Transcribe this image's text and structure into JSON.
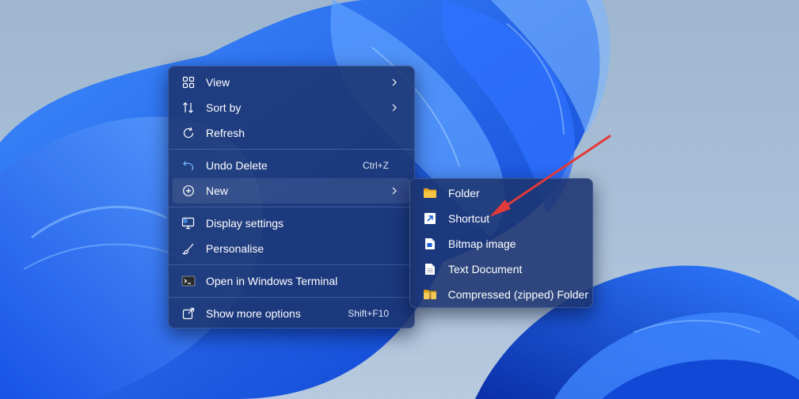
{
  "context_menu": {
    "items": [
      {
        "label": "View",
        "icon": "grid-icon",
        "submenu": true
      },
      {
        "label": "Sort by",
        "icon": "sort-icon",
        "submenu": true
      },
      {
        "label": "Refresh",
        "icon": "refresh-icon"
      },
      {
        "label": "Undo Delete",
        "icon": "undo-icon",
        "shortcut": "Ctrl+Z"
      },
      {
        "label": "New",
        "icon": "plus-circle-icon",
        "submenu": true,
        "highlighted": true
      },
      {
        "label": "Display settings",
        "icon": "display-settings-icon"
      },
      {
        "label": "Personalise",
        "icon": "brush-icon"
      },
      {
        "label": "Open in Windows Terminal",
        "icon": "terminal-icon"
      },
      {
        "label": "Show more options",
        "icon": "share-icon",
        "shortcut": "Shift+F10"
      }
    ]
  },
  "new_submenu": {
    "items": [
      {
        "label": "Folder",
        "icon": "folder-icon"
      },
      {
        "label": "Shortcut",
        "icon": "shortcut-icon"
      },
      {
        "label": "Bitmap image",
        "icon": "bitmap-icon"
      },
      {
        "label": "Text Document",
        "icon": "text-document-icon"
      },
      {
        "label": "Compressed (zipped) Folder",
        "icon": "zip-folder-icon"
      }
    ]
  },
  "colors": {
    "menu_background": "#1c3470",
    "annotation_arrow": "#e03a3a",
    "folder_yellow": "#f6c342"
  }
}
